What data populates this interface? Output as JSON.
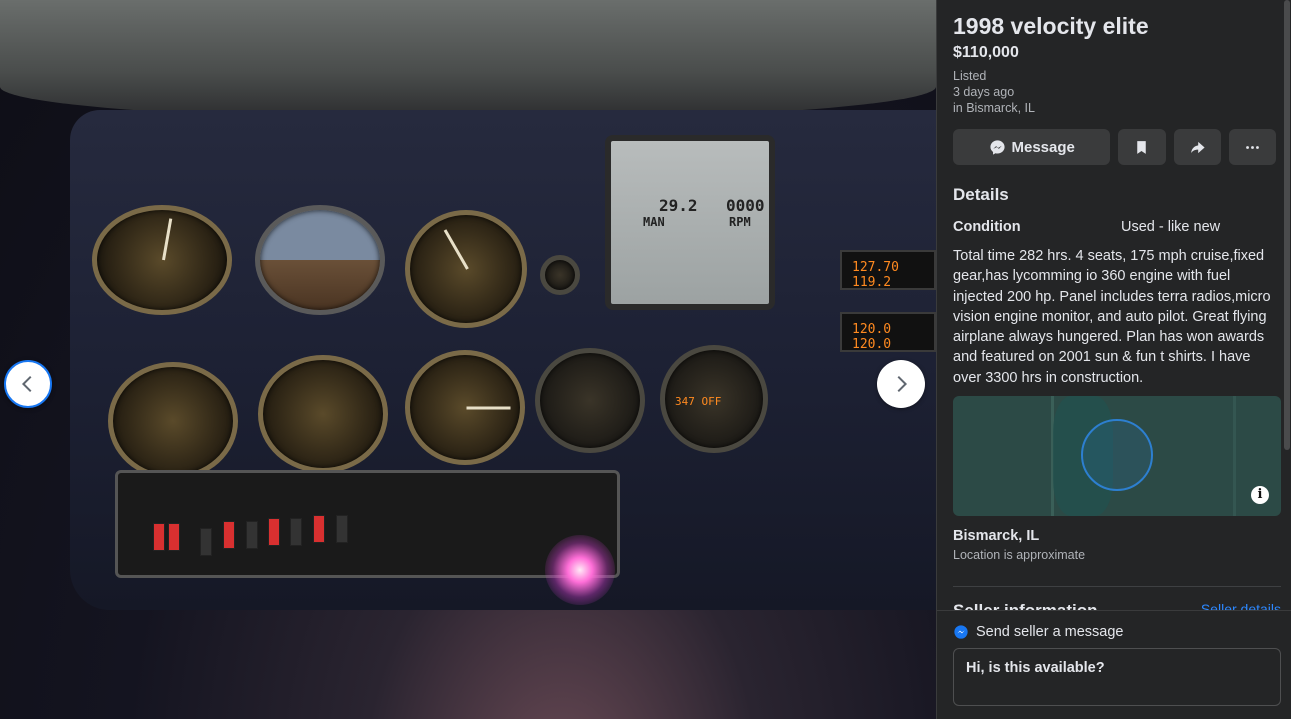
{
  "listing": {
    "title": "1998 velocity elite",
    "price": "$110,000",
    "listed_label": "Listed",
    "listed_when": "3 days ago",
    "listed_where": "in Bismarck, IL"
  },
  "actions": {
    "message_label": "Message",
    "save_icon": "bookmark-icon",
    "share_icon": "share-icon",
    "more_icon": "more-icon"
  },
  "details": {
    "heading": "Details",
    "condition_label": "Condition",
    "condition_value": "Used - like new",
    "description": "Total time 282 hrs. 4 seats, 175 mph cruise,fixed gear,has lycomming io 360 engine with fuel injected 200 hp.  Panel includes terra radios,micro vision engine monitor, and auto pilot. Great flying airplane always hungered.  Plan has won awards and featured on 2001 sun & fun t shirts.  I have over 3300 hrs in construction."
  },
  "location": {
    "city": "Bismarck, IL",
    "note": "Location is approximate"
  },
  "seller": {
    "heading": "Seller information",
    "details_link": "Seller details"
  },
  "send": {
    "label": "Send seller a message",
    "value": "Hi, is this available?"
  },
  "photo": {
    "screen_manifold": "29.2",
    "screen_man_label": "MAN",
    "screen_rpm_digits": "0000",
    "screen_rpm_label": "RPM",
    "radio1": "127.70  119.2",
    "radio2": "120.0  120.0",
    "autopilot": "347  OFF"
  },
  "colors": {
    "accent": "#1877f2",
    "panel_bg": "#242526",
    "link": "#2d88ff"
  }
}
